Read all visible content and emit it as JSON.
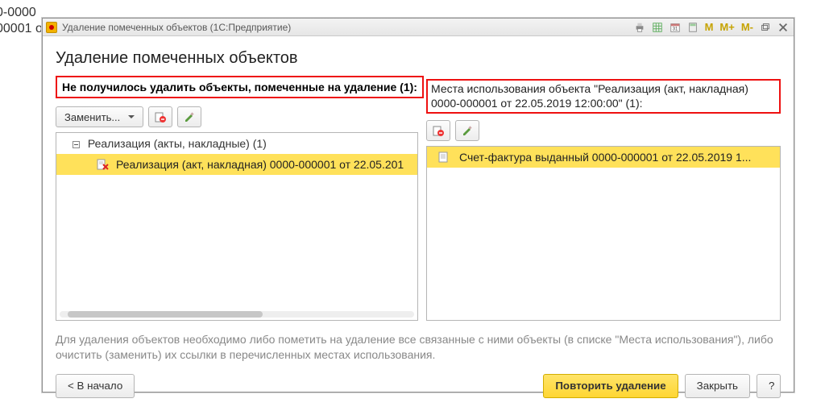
{
  "background": {
    "line1": "0-0000",
    "line2": "00001 о"
  },
  "titlebar": {
    "title": "Удаление помеченных объектов  (1С:Предприятие)"
  },
  "page": {
    "heading": "Удаление помеченных объектов",
    "warning": "Не получилось удалить объекты, помеченные на удаление (1):"
  },
  "left": {
    "replace_btn": "Заменить...",
    "tree_group": "Реализация (акты, накладные) (1)",
    "selected_row": "Реализация (акт, накладная) 0000-000001 от 22.05.201"
  },
  "right": {
    "usage_header": "Места использования объекта \"Реализация (акт, накладная) 0000-000001 от 22.05.2019 12:00:00\" (1):",
    "row": "Счет-фактура выданный 0000-000001 от 22.05.2019 1..."
  },
  "hint": "Для удаления объектов необходимо либо пометить на удаление все связанные с ними объекты (в списке \"Места использования\"), либо очистить (заменить) их ссылки в перечисленных местах использования.",
  "footer": {
    "back": "< В начало",
    "retry": "Повторить удаление",
    "close": "Закрыть",
    "help": "?"
  }
}
